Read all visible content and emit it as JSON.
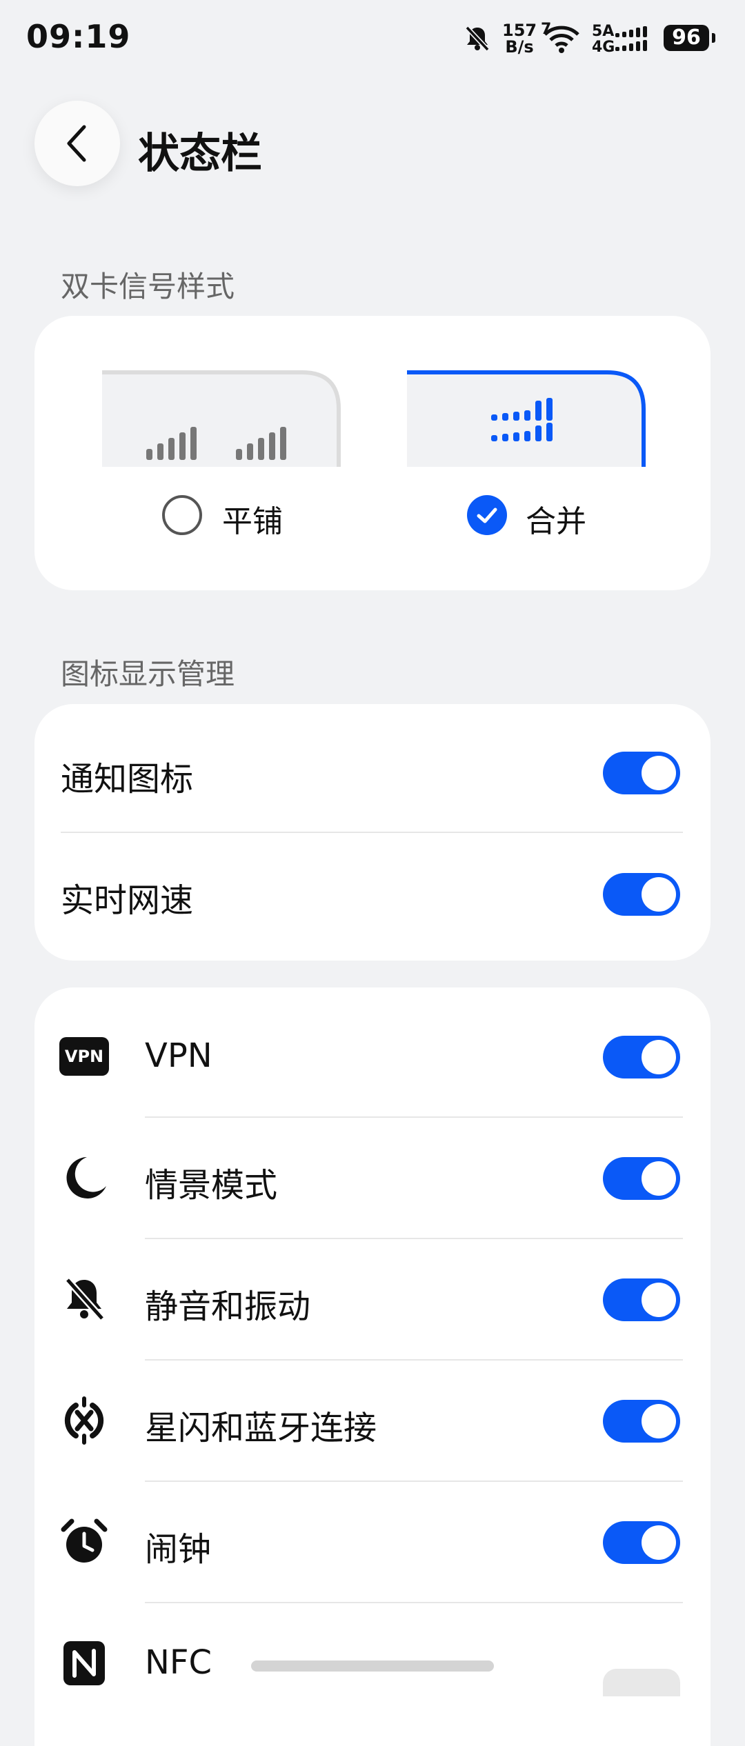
{
  "status_bar": {
    "time": "09:19",
    "speed_value": "157",
    "speed_unit": "B/s",
    "wifi_badge": "7",
    "sim_top": "5A",
    "sim_bottom": "4G",
    "battery": "96"
  },
  "header": {
    "title": "状态栏"
  },
  "sim_section": {
    "title": "双卡信号样式",
    "options": [
      {
        "label": "平铺",
        "selected": false
      },
      {
        "label": "合并",
        "selected": true
      }
    ]
  },
  "icon_section": {
    "title": "图标显示管理",
    "rows": [
      {
        "label": "通知图标",
        "on": true
      },
      {
        "label": "实时网速",
        "on": true
      }
    ]
  },
  "icon_list": [
    {
      "label": "VPN",
      "icon": "vpn-icon",
      "on": true
    },
    {
      "label": "情景模式",
      "icon": "moon-icon",
      "on": true
    },
    {
      "label": "静音和振动",
      "icon": "bell-off-icon",
      "on": true
    },
    {
      "label": "星闪和蓝牙连接",
      "icon": "bluetooth-nearlink-icon",
      "on": true
    },
    {
      "label": "闹钟",
      "icon": "alarm-icon",
      "on": true
    },
    {
      "label": "NFC",
      "icon": "nfc-icon",
      "on": true
    }
  ],
  "colors": {
    "accent": "#0a59f7",
    "background": "#f1f2f4",
    "card": "#ffffff"
  }
}
